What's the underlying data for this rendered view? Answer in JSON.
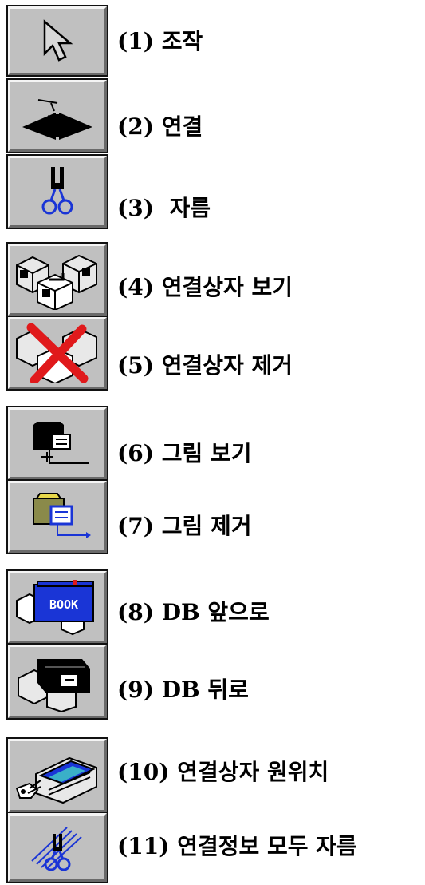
{
  "toolbar": {
    "items": [
      {
        "icon": "pointer-arrow-icon",
        "label": "(1) 조작"
      },
      {
        "icon": "link-connect-icon",
        "label": "(2) 연결"
      },
      {
        "icon": "scissors-icon",
        "label": "(3)  자름"
      },
      {
        "icon": "show-link-box-icon",
        "label": "(4) 연결상자 보기"
      },
      {
        "icon": "remove-link-box-icon",
        "label": "(5) 연결상자 제거"
      },
      {
        "icon": "show-picture-icon",
        "label": "(6) 그림 보기"
      },
      {
        "icon": "remove-picture-icon",
        "label": "(7) 그림 제거"
      },
      {
        "icon": "db-forward-icon",
        "label": "(8) DB 앞으로",
        "badge": "BOOK"
      },
      {
        "icon": "db-backward-icon",
        "label": "(9) DB 뒤로"
      },
      {
        "icon": "reset-link-box-icon",
        "label": "(10) 연결상자 원위치"
      },
      {
        "icon": "cut-all-links-icon",
        "label": "(11) 연결정보 모두 자름"
      }
    ]
  },
  "colors": {
    "button_face": "#c0c0c0",
    "accent_blue": "#1a35d6",
    "accent_red": "#e0191b"
  }
}
